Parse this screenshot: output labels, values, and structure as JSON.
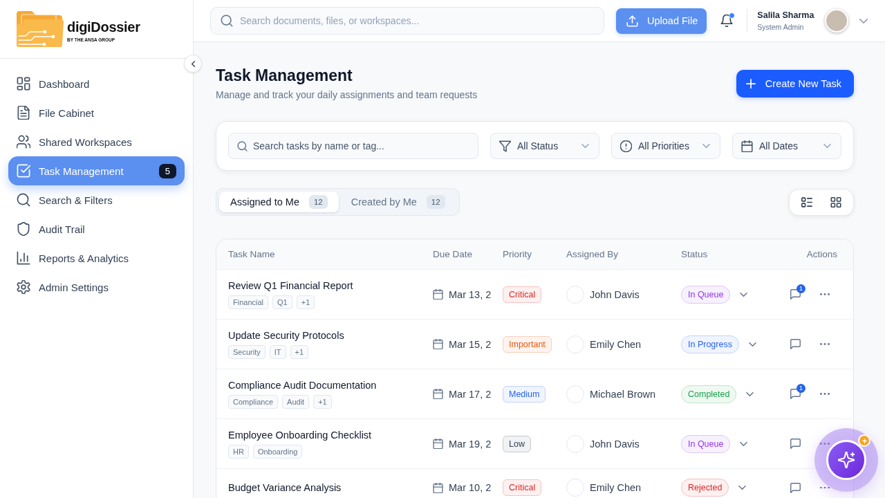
{
  "sidebar": {
    "brand": {
      "name": "digiDossier",
      "tagline": "BY THE ANSA GROUP"
    },
    "nav": [
      {
        "label": "Dashboard",
        "selected": false
      },
      {
        "label": "File Cabinet",
        "selected": false
      },
      {
        "label": "Shared Workspaces",
        "selected": false
      },
      {
        "label": "Task Management",
        "selected": true,
        "badge": "5"
      },
      {
        "label": "Search & Filters",
        "selected": false
      },
      {
        "label": "Audit Trail",
        "selected": false
      },
      {
        "label": "Reports & Analytics",
        "selected": false
      },
      {
        "label": "Admin Settings",
        "selected": false
      }
    ]
  },
  "header": {
    "search": {
      "placeholder": "Search documents, files, or workspaces..."
    },
    "upload_button": "Upload File",
    "notifications": {
      "unread": true
    },
    "user": {
      "name": "Salila Sharma",
      "role": "System Admin"
    }
  },
  "page": {
    "title": "Task Management",
    "subtitle": "Manage and track your daily assignments and team requests",
    "create_button": "Create New Task"
  },
  "filters": {
    "search": {
      "placeholder": "Search tasks by name or tag..."
    },
    "dropdowns": [
      "All Status",
      "All Priorities",
      "All Dates"
    ]
  },
  "tabs": [
    {
      "label": "Assigned to Me",
      "count": "12",
      "selected": true
    },
    {
      "label": "Created by Me",
      "count": "12",
      "selected": false
    }
  ],
  "table": {
    "columns": [
      "Task Name",
      "Due Date",
      "Priority",
      "Assigned By",
      "Status",
      "Actions"
    ],
    "rows": [
      {
        "name": "Review Q1 Financial Report",
        "tags": [
          "Financial",
          "Q1",
          "+1"
        ],
        "due": "Mar 13, 2",
        "priority": {
          "label": "Critical",
          "color": "#dc2626"
        },
        "assigned_by": "John Davis",
        "status": {
          "label": "In Queue",
          "color": "#9333ea"
        },
        "comments": "1"
      },
      {
        "name": "Update Security Protocols",
        "tags": [
          "Security",
          "IT",
          "+1"
        ],
        "due": "Mar 15, 2",
        "priority": {
          "label": "Important",
          "color": "#ea580c"
        },
        "assigned_by": "Emily Chen",
        "status": {
          "label": "In Progress",
          "color": "#2563eb"
        }
      },
      {
        "name": "Compliance Audit Documentation",
        "tags": [
          "Compliance",
          "Audit",
          "+1"
        ],
        "due": "Mar 17, 2",
        "priority": {
          "label": "Medium",
          "color": "#2563eb"
        },
        "assigned_by": "Michael Brown",
        "status": {
          "label": "Completed",
          "color": "#16a34a"
        },
        "comments": "1"
      },
      {
        "name": "Employee Onboarding Checklist",
        "tags": [
          "HR",
          "Onboarding"
        ],
        "due": "Mar 19, 2",
        "priority": {
          "label": "Low",
          "color": "#334155"
        },
        "assigned_by": "John Davis",
        "status": {
          "label": "In Queue",
          "color": "#9333ea"
        }
      },
      {
        "name": "Budget Variance Analysis",
        "due": "Mar 10, 2",
        "priority": {
          "label": "Critical",
          "color": "#dc2626"
        },
        "assigned_by": "Emily Chen",
        "status": {
          "label": "Rejected",
          "color": "#dc2626"
        }
      }
    ]
  }
}
